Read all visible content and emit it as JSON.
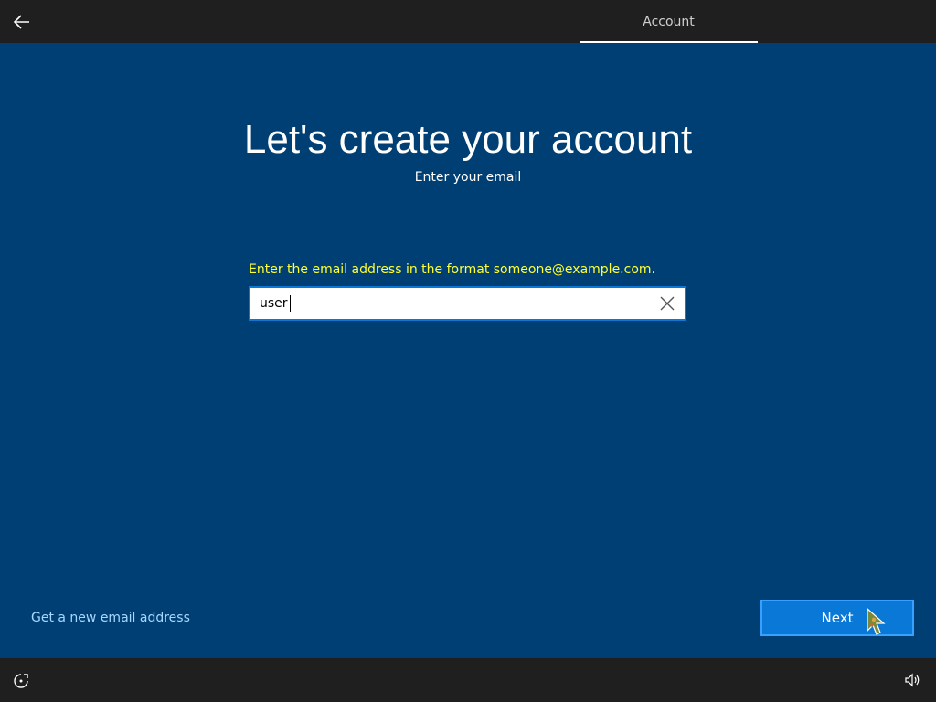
{
  "header": {
    "back_icon": "back-arrow-icon",
    "step_label": "Account"
  },
  "content": {
    "title": "Let's create your account",
    "subtitle": "Enter your email",
    "error_message": "Enter the email address in the format someone@example.com.",
    "email_input": {
      "value": "user",
      "clear_icon": "close-icon"
    }
  },
  "footer": {
    "new_email_link": "Get a new email address",
    "next_label": "Next"
  },
  "taskbar": {
    "accessibility_icon": "accessibility-icon",
    "volume_icon": "volume-icon"
  },
  "colors": {
    "background": "#003f73",
    "bars": "#1f1f1f",
    "error": "#ffff33",
    "link": "#a9d7ff",
    "accent": "#0a78d7"
  }
}
